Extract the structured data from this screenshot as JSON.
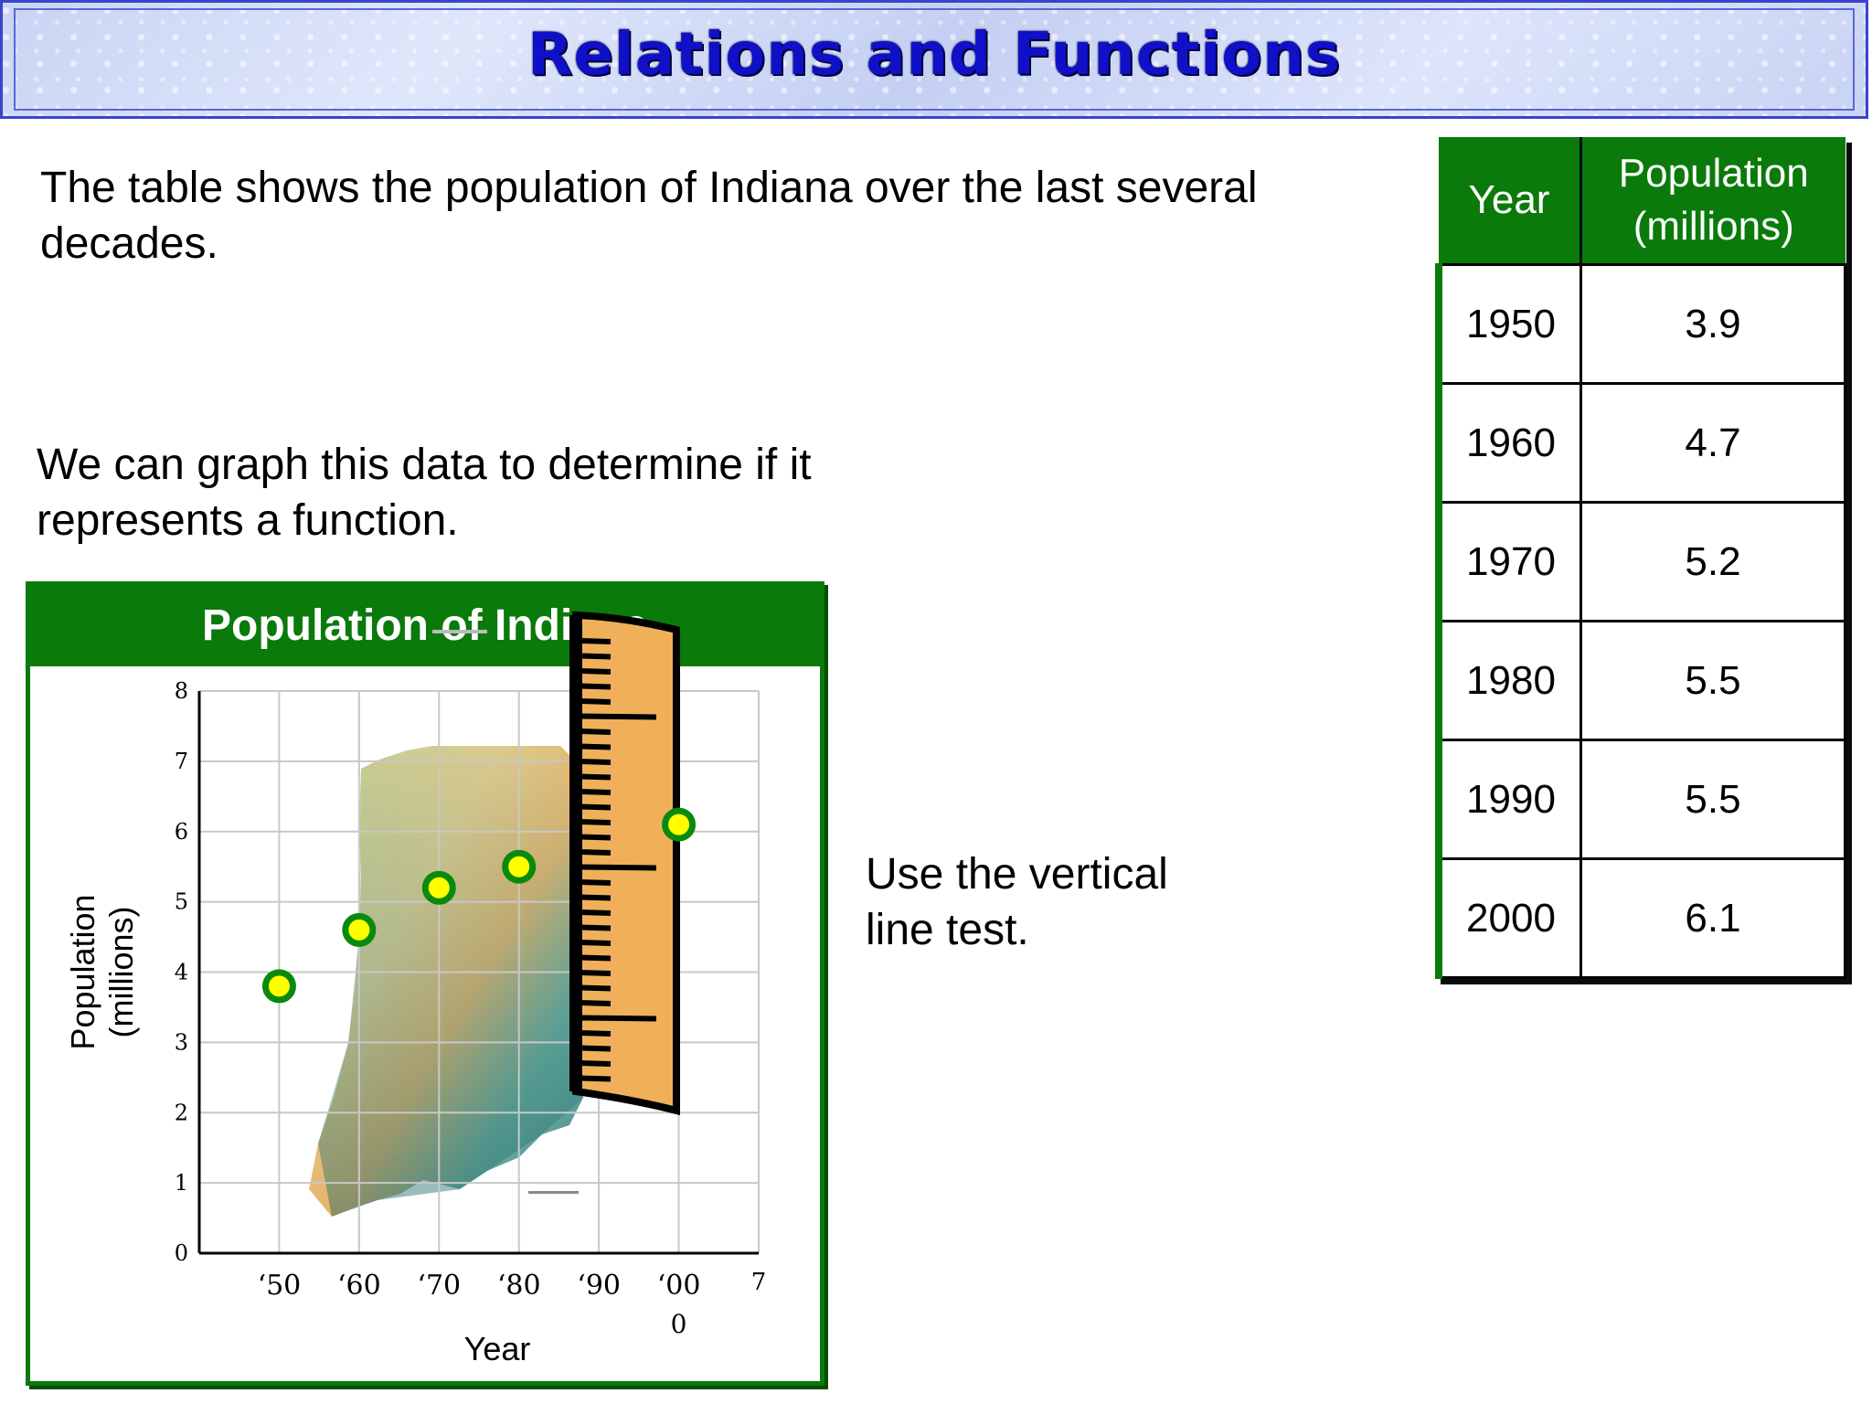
{
  "slide": {
    "title": "Relations and Functions",
    "intro": "The table shows the population of Indiana over the last several decades.",
    "graph_text": "We can graph this data to determine if it represents a function.",
    "vertical_line_text": "Use the vertical line test."
  },
  "table": {
    "headers": [
      "Year",
      "Population (millions)"
    ],
    "rows": [
      [
        "1950",
        "3.9"
      ],
      [
        "1960",
        "4.7"
      ],
      [
        "1970",
        "5.2"
      ],
      [
        "1980",
        "5.5"
      ],
      [
        "1990",
        "5.5"
      ],
      [
        "2000",
        "6.1"
      ]
    ]
  },
  "chart_data": {
    "type": "scatter",
    "title": "Population of Indiana",
    "xlabel": "Year",
    "ylabel": "Population (millions)",
    "x_tick_labels": [
      "‘50",
      "‘60",
      "‘70",
      "‘80",
      "‘90",
      "‘00"
    ],
    "x_tick_labels_extra": [
      "0",
      "7"
    ],
    "y_ticks": [
      0,
      1,
      2,
      3,
      4,
      5,
      6,
      7,
      8
    ],
    "ylim": [
      0,
      8
    ],
    "grid": true,
    "points": [
      {
        "x": "‘50",
        "y": 3.8
      },
      {
        "x": "‘60",
        "y": 4.6
      },
      {
        "x": "‘70",
        "y": 5.2
      },
      {
        "x": "‘80",
        "y": 5.5
      },
      {
        "x": "‘00",
        "y": 6.1
      }
    ],
    "point_fill": "#ffff00",
    "point_stroke": "#0a8a0a",
    "ruler_color": "#f0b05a"
  },
  "colors": {
    "accent_green": "#0a7a0a",
    "title_blue": "#1010c8"
  }
}
